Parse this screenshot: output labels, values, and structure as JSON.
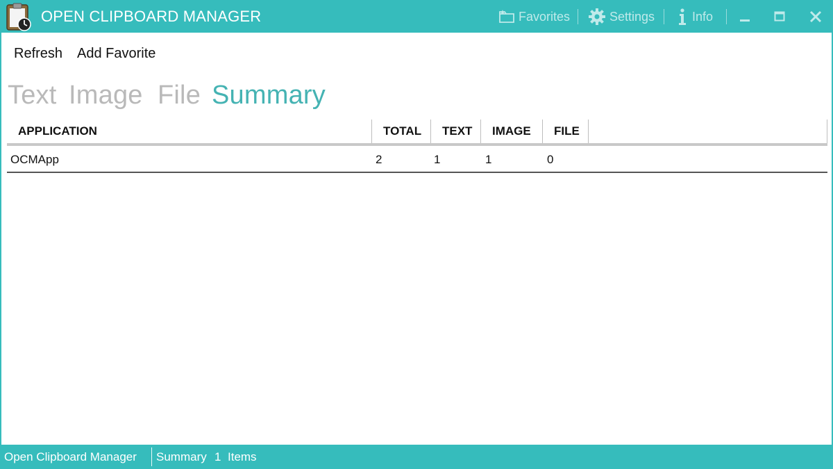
{
  "window": {
    "title": "OPEN CLIPBOARD MANAGER",
    "accent_color": "#36bcbc",
    "app_icon": "clipboard-clock-icon"
  },
  "titlebar": {
    "favorites_label": "Favorites",
    "favorites_icon": "folder-star-icon",
    "settings_label": "Settings",
    "settings_icon": "gear-icon",
    "info_label": "Info",
    "info_icon": "info-icon",
    "minimize_icon": "minimize-icon",
    "maximize_icon": "maximize-icon",
    "close_icon": "close-icon"
  },
  "commands": {
    "refresh_label": "Refresh",
    "add_favorite_label": "Add Favorite"
  },
  "tabs": [
    {
      "label": "Text",
      "active": false
    },
    {
      "label": "Image",
      "active": false
    },
    {
      "label": "File",
      "active": false
    },
    {
      "label": "Summary",
      "active": true
    }
  ],
  "table": {
    "columns": [
      "APPLICATION",
      "TOTAL",
      "TEXT",
      "IMAGE",
      "FILE"
    ],
    "rows": [
      {
        "application": "OCMApp",
        "total": "2",
        "text": "1",
        "image": "1",
        "file": "0"
      }
    ]
  },
  "statusbar": {
    "app_name": "Open Clipboard Manager",
    "view": "Summary",
    "count": "1",
    "items_label": "Items"
  }
}
